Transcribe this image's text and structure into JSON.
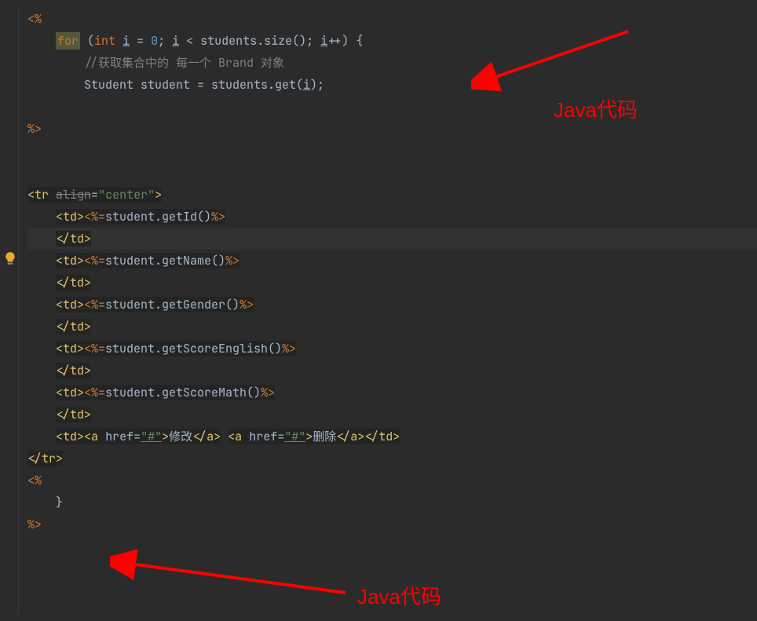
{
  "annotations": {
    "label1": "Java代码",
    "label2": "Java代码"
  },
  "code": {
    "l1_jsp_open": "<%",
    "l2_for": "for",
    "l2_int": "int",
    "l2_i1": "i",
    "l2_eq": " = ",
    "l2_zero": "0",
    "l2_semi1": "; ",
    "l2_i2": "i",
    "l2_cond": " < students.size(); ",
    "l2_i3": "i",
    "l2_inc": "++) {",
    "l2_paren_open": " (",
    "l3_comment_prefix": "//",
    "l3_comment_text": "获取集合中的 每一个 Brand 对象",
    "l4_stmt_pre": "Student student = students.get(",
    "l4_i": "i",
    "l4_stmt_post": ");",
    "l5_jsp_close": "%>",
    "l6_tr_open": "<tr",
    "l6_attr_align": "align",
    "l6_eq": "=",
    "l6_attr_val": "\"center\"",
    "l6_close": ">",
    "l7_td_open": "<td>",
    "l7_jsp_open": "<%=",
    "l7_expr": "student.getId()",
    "l7_jsp_close": "%>",
    "l8_td_close": "</td>",
    "l9_td_open": "<td>",
    "l9_jsp_open": "<%=",
    "l9_expr": "student.getName()",
    "l9_jsp_close": "%>",
    "l10_td_close": "</td>",
    "l11_td_open": "<td>",
    "l11_jsp_open": "<%=",
    "l11_expr": "student.getGender()",
    "l11_jsp_close": "%>",
    "l12_td_close": "</td>",
    "l13_td_open": "<td>",
    "l13_jsp_open": "<%=",
    "l13_expr": "student.getScoreEnglish()",
    "l13_jsp_close": "%>",
    "l14_td_close": "</td>",
    "l15_td_open": "<td>",
    "l15_jsp_open": "<%=",
    "l15_expr": "student.getScoreMath()",
    "l15_jsp_close": "%>",
    "l16_td_close": "</td>",
    "l17_td_open": "<td>",
    "l17_a1_open": "<a",
    "l17_href": "href",
    "l17_eq": "=",
    "l17_hash": "\"#\"",
    "l17_a1_close": ">",
    "l17_text1": "修改",
    "l17_a1_end": "</a>",
    "l17_space": " ",
    "l17_a2_open": "<a",
    "l17_text2": "删除",
    "l17_a2_end": "</a>",
    "l17_td_close": "</td>",
    "l18_tr_close": "</tr>",
    "l19_jsp_open": "<%",
    "l20_brace": "}",
    "l21_jsp_close": "%>"
  }
}
